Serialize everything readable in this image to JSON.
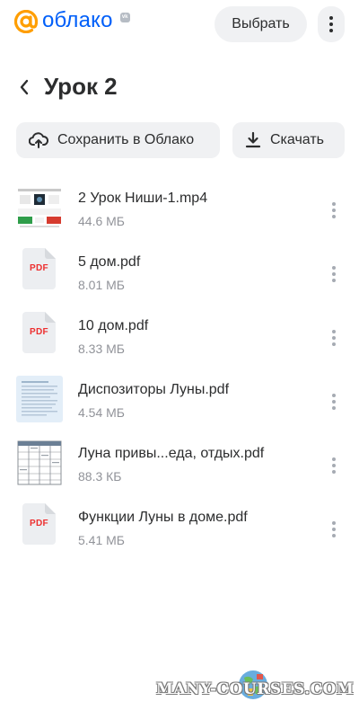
{
  "header": {
    "logo_text": "облако",
    "vk_badge": "vk",
    "select_label": "Выбрать",
    "brand_color": "#005ff9",
    "accent_color": "#ff9e00"
  },
  "page": {
    "title": "Урок 2"
  },
  "actions": {
    "save_label": "Сохранить в Облако",
    "download_label": "Скачать"
  },
  "files": [
    {
      "name": "2 Урок Ниши-1.mp4",
      "size": "44.6 МБ",
      "thumb": "video-thumbnail"
    },
    {
      "name": "5 дом.pdf",
      "size": "8.01 МБ",
      "thumb": "pdf-icon",
      "badge": "PDF"
    },
    {
      "name": "10 дом.pdf",
      "size": "8.33 МБ",
      "thumb": "pdf-icon",
      "badge": "PDF"
    },
    {
      "name": "Диспозиторы Луны.pdf",
      "size": "4.54 МБ",
      "thumb": "document-thumbnail"
    },
    {
      "name": "Луна привы...еда, отдых.pdf",
      "size": "88.3 КБ",
      "thumb": "table-thumbnail"
    },
    {
      "name": "Функции Луны в доме.pdf",
      "size": "5.41 МБ",
      "thumb": "pdf-icon",
      "badge": "PDF"
    }
  ],
  "watermark": {
    "text": "MANY-COURSES.COM"
  }
}
